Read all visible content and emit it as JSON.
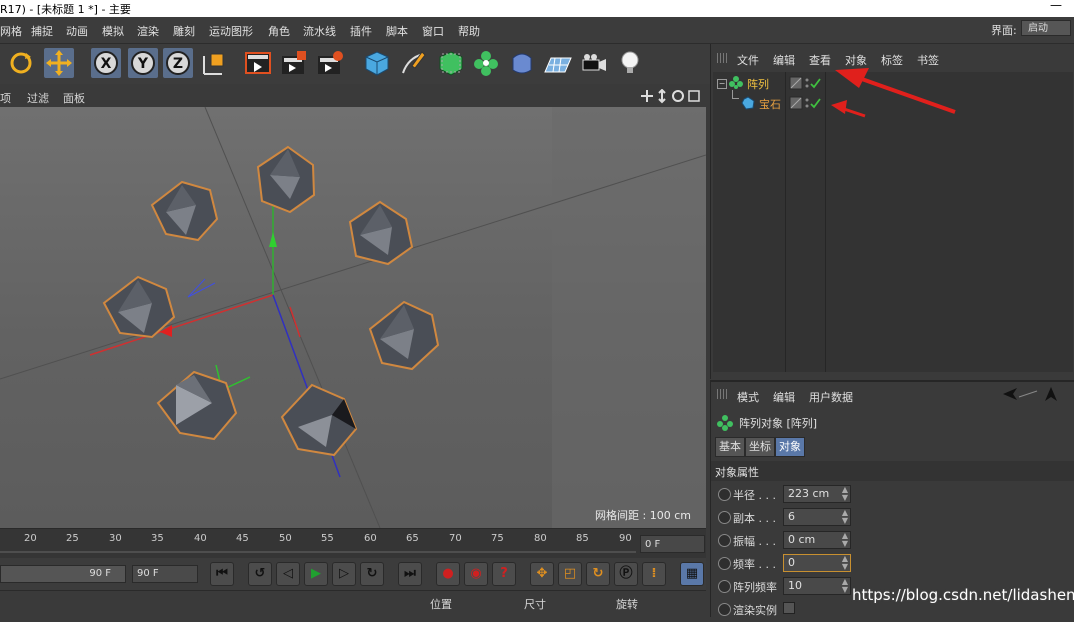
{
  "window": {
    "title": "R17) - [未标题 1 *] - 主要",
    "minimize": "—"
  },
  "menubar": {
    "items": [
      "网格",
      "捕捉",
      "动画",
      "模拟",
      "渲染",
      "雕刻",
      "运动图形",
      "角色",
      "流水线",
      "插件",
      "脚本",
      "窗口",
      "帮助"
    ],
    "layout_label": "界面:",
    "layout_value": "启动"
  },
  "toolbar": {
    "buttons": [
      {
        "icon": "rotate-icon"
      },
      {
        "icon": "move-icon"
      },
      {
        "icon": "x-axis-lock-icon",
        "label": "X"
      },
      {
        "icon": "y-axis-lock-icon",
        "label": "Y"
      },
      {
        "icon": "z-axis-lock-icon",
        "label": "Z"
      },
      {
        "icon": "coordinate-system-icon"
      },
      {
        "icon": "render-view-icon"
      },
      {
        "icon": "render-picture-viewer-icon"
      },
      {
        "icon": "render-settings-icon"
      },
      {
        "icon": "cube-primitive-icon"
      },
      {
        "icon": "pen-spline-icon"
      },
      {
        "icon": "subdivision-icon"
      },
      {
        "icon": "mograph-cloner-icon"
      },
      {
        "icon": "deformer-icon"
      },
      {
        "icon": "floor-icon"
      },
      {
        "icon": "camera-icon"
      },
      {
        "icon": "light-icon"
      }
    ]
  },
  "viewport": {
    "menu": [
      "项",
      "过滤",
      "面板"
    ],
    "grid_spacing": "网格间距 : 100 cm"
  },
  "timeline": {
    "ticks": [
      "20",
      "25",
      "30",
      "35",
      "40",
      "45",
      "50",
      "55",
      "60",
      "65",
      "70",
      "75",
      "80",
      "85",
      "90"
    ],
    "current_frame": "0 F"
  },
  "playback": {
    "end_frame_slider": "90 F",
    "end_frame_field": "90 F"
  },
  "coordinates": {
    "headers": [
      "位置",
      "尺寸",
      "旋转"
    ]
  },
  "object_manager": {
    "menu": [
      "文件",
      "编辑",
      "查看",
      "对象",
      "标签",
      "书签"
    ],
    "objects": [
      {
        "name": "阵列",
        "level": 0
      },
      {
        "name": "宝石",
        "level": 1
      }
    ]
  },
  "attribute_manager": {
    "menu": [
      "模式",
      "编辑",
      "用户数据"
    ],
    "title": "阵列对象 [阵列]",
    "tabs": [
      "基本",
      "坐标",
      "对象"
    ],
    "active_tab": "对象",
    "section": "对象属性",
    "params": [
      {
        "label": "半径 . . .",
        "value": "223 cm"
      },
      {
        "label": "副本 . . .",
        "value": "6"
      },
      {
        "label": "振幅 . . .",
        "value": "0 cm"
      },
      {
        "label": "频率 . . .",
        "value": "0"
      },
      {
        "label": "阵列频率",
        "value": "10"
      },
      {
        "label": "渲染实例",
        "value": ""
      }
    ]
  },
  "watermark": "https://blog.csdn.net/lidashent",
  "colors": {
    "selection_orange": "#e8a040",
    "highlight_blue": "#5a78a8",
    "annotation_red": "#e0201c"
  }
}
